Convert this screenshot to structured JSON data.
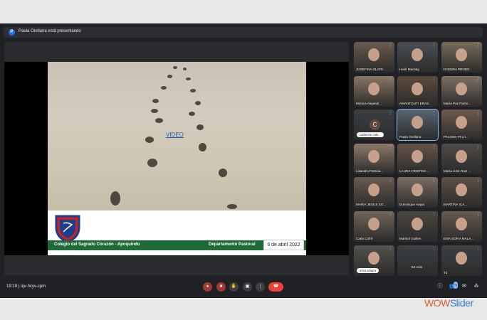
{
  "presenter": {
    "initial": "P",
    "text": "Paula Orellana está presentando"
  },
  "slide": {
    "link": "VIDEO",
    "school": "Colegio del Sagrado Corazón - Apoquindo",
    "department": "Departamento Pastoral",
    "date": "6 de abril 2022"
  },
  "tiles": [
    {
      "name": "JOSEFINA OLATE..."
    },
    {
      "name": "Heidi Machtig"
    },
    {
      "name": "ISIDORA PROBO..."
    },
    {
      "name": "Mónica Alejandr..."
    },
    {
      "name": "AMANTZAITI ERAS..."
    },
    {
      "name": "María Paz Parho..."
    },
    {
      "name": "catherine cale..."
    },
    {
      "name": "Paula Orellana"
    },
    {
      "name": "PALOMA PI LA..."
    },
    {
      "name": "Lisandro Patricia..."
    },
    {
      "name": "LAURA CRISTINA ..."
    },
    {
      "name": "María José Ruiz ..."
    },
    {
      "name": "MARIA JESUS SO..."
    },
    {
      "name": "Dominique Araya"
    },
    {
      "name": "MARTINA ICA..."
    },
    {
      "name": "Carla Cofré"
    },
    {
      "name": "Marisol Guillen"
    },
    {
      "name": "EMA SOFIA MALA..."
    },
    {
      "name": "erica azagra"
    },
    {
      "name": "53 más"
    },
    {
      "name": "Tú"
    }
  ],
  "bottom": {
    "time": "19:19",
    "separator": "|",
    "code": "ojv-hcyv-cpm",
    "people_count": "76"
  },
  "watermark": {
    "part1": "WOW",
    "part2": "Slider"
  }
}
